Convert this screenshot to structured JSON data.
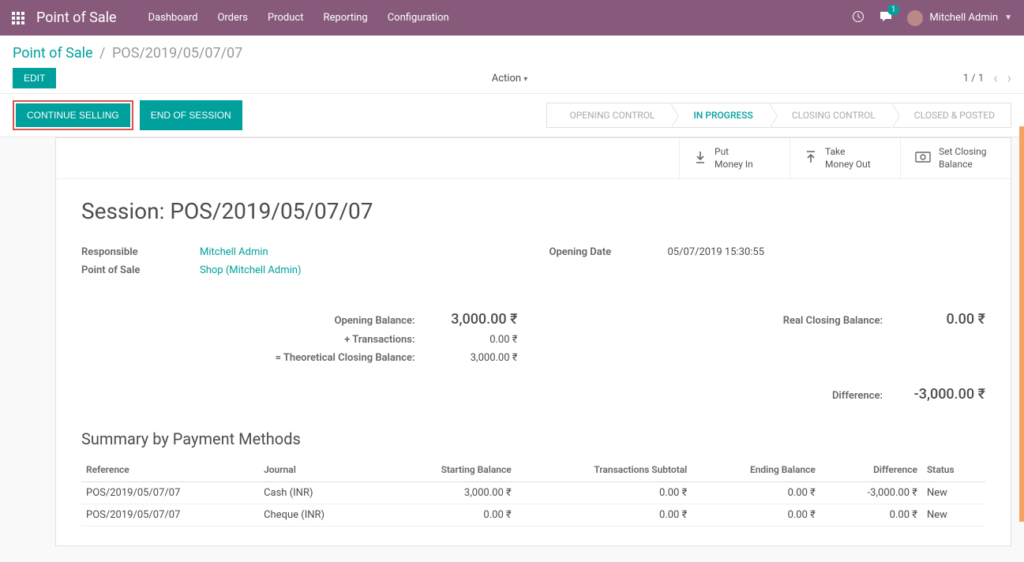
{
  "header": {
    "app_title": "Point of Sale",
    "nav": [
      "Dashboard",
      "Orders",
      "Product",
      "Reporting",
      "Configuration"
    ],
    "chat_count": "1",
    "user_name": "Mitchell Admin"
  },
  "breadcrumb": {
    "root": "Point of Sale",
    "current": "POS/2019/05/07/07",
    "edit_label": "EDIT",
    "action_label": "Action",
    "pager": "1 / 1"
  },
  "statusbar": {
    "continue_label": "CONTINUE SELLING",
    "end_label": "END OF SESSION",
    "stages": [
      "OPENING CONTROL",
      "IN PROGRESS",
      "CLOSING CONTROL",
      "CLOSED & POSTED"
    ],
    "active_stage": 1
  },
  "sheet_actions": [
    {
      "icon": "↧",
      "line1": "Put",
      "line2": "Money In"
    },
    {
      "icon": "↥",
      "line1": "Take",
      "line2": "Money Out"
    },
    {
      "icon": "⏢",
      "line1": "Set Closing",
      "line2": "Balance"
    }
  ],
  "session": {
    "title": "Session: POS/2019/05/07/07",
    "responsible_label": "Responsible",
    "responsible": "Mitchell Admin",
    "pos_label": "Point of Sale",
    "pos": "Shop (Mitchell Admin)",
    "opening_date_label": "Opening Date",
    "opening_date": "05/07/2019 15:30:55"
  },
  "balances": {
    "opening_label": "Opening Balance:",
    "opening_value": "3,000.00 ₹",
    "transactions_label": "+ Transactions:",
    "transactions_value": "0.00 ₹",
    "theoretical_label": "= Theoretical Closing Balance:",
    "theoretical_value": "3,000.00 ₹",
    "real_closing_label": "Real Closing Balance:",
    "real_closing_value": "0.00 ₹",
    "difference_label": "Difference:",
    "difference_value": "-3,000.00 ₹"
  },
  "summary": {
    "title": "Summary by Payment Methods",
    "headers": {
      "reference": "Reference",
      "journal": "Journal",
      "starting": "Starting Balance",
      "subtotal": "Transactions Subtotal",
      "ending": "Ending Balance",
      "difference": "Difference",
      "status": "Status"
    },
    "rows": [
      {
        "reference": "POS/2019/05/07/07",
        "journal": "Cash (INR)",
        "starting": "3,000.00 ₹",
        "subtotal": "0.00 ₹",
        "ending": "0.00 ₹",
        "difference": "-3,000.00 ₹",
        "status": "New"
      },
      {
        "reference": "POS/2019/05/07/07",
        "journal": "Cheque (INR)",
        "starting": "0.00 ₹",
        "subtotal": "0.00 ₹",
        "ending": "0.00 ₹",
        "difference": "0.00 ₹",
        "status": "New"
      }
    ]
  }
}
